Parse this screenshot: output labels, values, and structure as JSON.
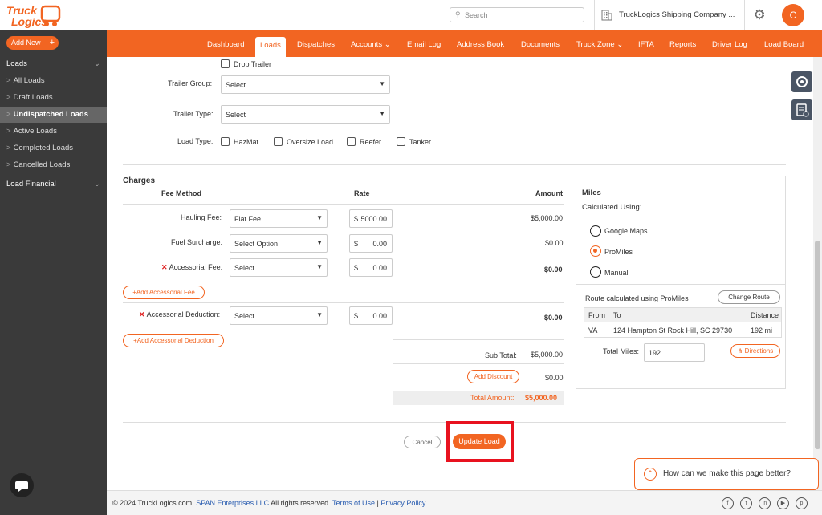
{
  "header": {
    "logo_text_1": "Truck",
    "logo_text_2": "Logics",
    "search_placeholder": "Search",
    "company_name": "TruckLogics Shipping Company ...",
    "avatar_initial": "C"
  },
  "nav": {
    "items": [
      "Dashboard",
      "Loads",
      "Dispatches",
      "Accounts",
      "Email Log",
      "Address Book",
      "Documents",
      "Truck Zone",
      "IFTA",
      "Reports",
      "Driver Log",
      "Load Board"
    ],
    "active": "Loads"
  },
  "sidebar": {
    "add_new": "Add New",
    "section_loads": "Loads",
    "items": [
      "All Loads",
      "Draft Loads",
      "Undispatched Loads",
      "Active Loads",
      "Completed Loads",
      "Cancelled Loads"
    ],
    "selected": "Undispatched Loads",
    "section_financial": "Load Financial"
  },
  "trailer": {
    "drop_trailer_label": "Drop Trailer",
    "group_label": "Trailer Group:",
    "group_value": "Select",
    "type_label": "Trailer Type:",
    "type_value": "Select",
    "load_type_label": "Load Type:",
    "load_types": [
      "HazMat",
      "Oversize Load",
      "Reefer",
      "Tanker"
    ]
  },
  "charges": {
    "title": "Charges",
    "col_fee_method": "Fee Method",
    "col_rate": "Rate",
    "col_amount": "Amount",
    "rows": [
      {
        "label": "Hauling Fee:",
        "method": "Flat Fee",
        "currency": "$",
        "rate": "5000.00",
        "amount": "$5,000.00"
      },
      {
        "label": "Fuel Surcharge:",
        "method": "Select Option",
        "currency": "$",
        "rate": "0.00",
        "amount": "$0.00"
      },
      {
        "label": "Accessorial Fee:",
        "method": "Select",
        "currency": "$",
        "rate": "0.00",
        "amount": "$0.00"
      }
    ],
    "add_accessorial_fee": "Add Accessorial Fee",
    "deduction": {
      "label": "Accessorial Deduction:",
      "method": "Select",
      "currency": "$",
      "rate": "0.00",
      "amount": "$0.00"
    },
    "add_accessorial_deduction": "Add Accessorial Deduction",
    "sub_total_label": "Sub Total:",
    "sub_total_value": "$5,000.00",
    "add_discount": "Add Discount",
    "discount_value": "$0.00",
    "total_label": "Total Amount:",
    "total_value": "$5,000.00"
  },
  "miles": {
    "title": "Miles",
    "calculated_using": "Calculated Using:",
    "options": [
      "Google Maps",
      "ProMiles",
      "Manual"
    ],
    "selected": "ProMiles",
    "route_text": "Route calculated using ProMiles",
    "change_route": "Change Route",
    "col_from": "From",
    "col_to": "To",
    "col_distance": "Distance",
    "row_from": "VA",
    "row_to": "124 Hampton St Rock Hill, SC 29730",
    "row_distance": "192 mi",
    "total_miles_label": "Total Miles:",
    "total_miles_value": "192",
    "directions": "Directions"
  },
  "actions": {
    "cancel": "Cancel",
    "update_load": "Update Load"
  },
  "feedback": {
    "text": "How can we make this page better?"
  },
  "footer": {
    "copyright": "© 2024 TruckLogics.com,",
    "span_link": "SPAN Enterprises LLC",
    "rights": "All rights reserved.",
    "terms": "Terms of Use",
    "sep": "|",
    "privacy": "Privacy Policy"
  },
  "colors": {
    "brand": "#f26522",
    "sidebar": "#3a3a3a",
    "highlight": "#e8121f"
  }
}
